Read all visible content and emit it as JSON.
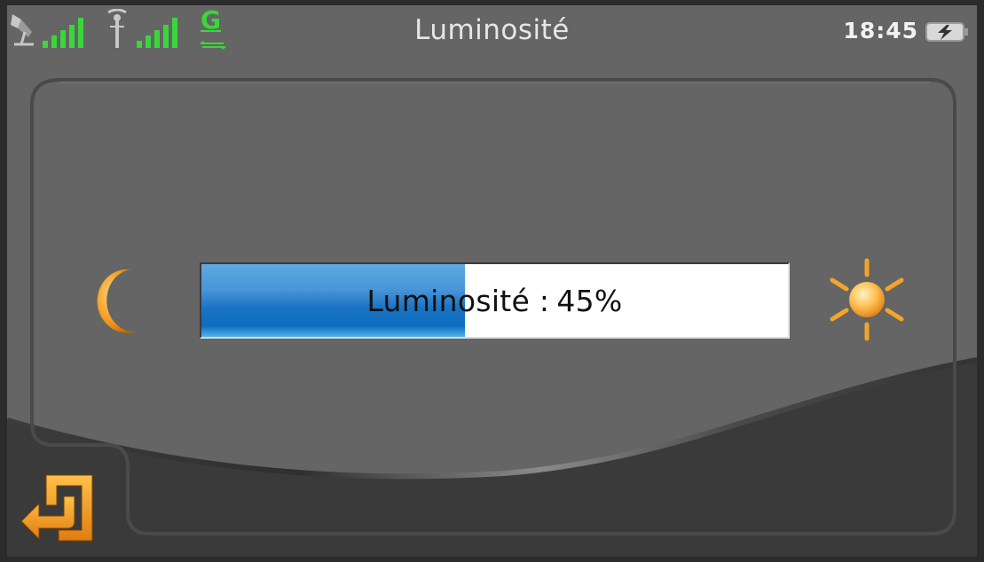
{
  "statusbar": {
    "title": "Luminosité",
    "clock": "18:45",
    "network_letter": "G",
    "icons": [
      "satellite-icon",
      "gps-signal-icon",
      "antenna-icon",
      "cell-signal-icon",
      "network-type-icon",
      "battery-charging-icon"
    ],
    "signal_color": "#3bd63b"
  },
  "brightness": {
    "label_prefix": "Luminosité :",
    "value_text": "45%",
    "level_percent": 45,
    "fill_color": "#1a73c3"
  },
  "icons": {
    "left": "moon-icon",
    "right": "sun-icon",
    "back": "back-icon"
  },
  "colors": {
    "accent": "#f39a1e",
    "panel": "#646564"
  }
}
